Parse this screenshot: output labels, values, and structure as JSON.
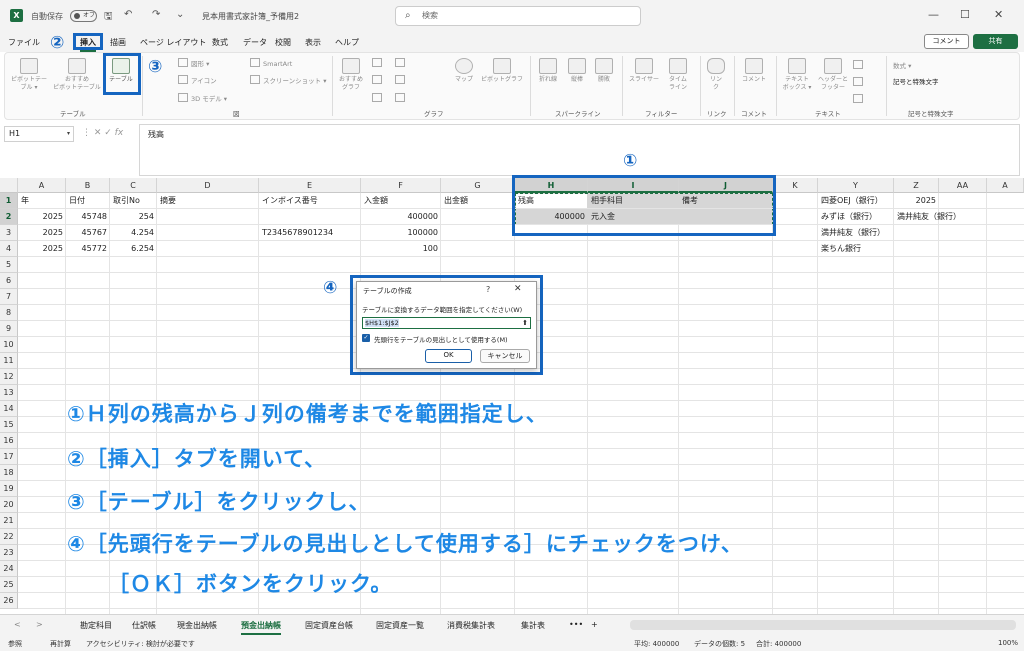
{
  "titlebar": {
    "autosave_label": "自動保存",
    "autosave_state": "オフ",
    "doc_title": "見本用書式家計簿_予備用2",
    "search_placeholder": "検索",
    "win_min": "—",
    "win_max": "☐",
    "win_close": "✕"
  },
  "menu": {
    "tabs": [
      "ファイル",
      "挿入",
      "描画",
      "ページ レイアウト",
      "数式",
      "データ",
      "校閲",
      "表示",
      "ヘルプ"
    ],
    "comment": "コメント",
    "share": "共有"
  },
  "ribbon": {
    "pivot": "ピボットテー\nブル ▾",
    "rec_pivot": "おすすめ\nピボットテーブル",
    "table": "テーブル",
    "shapes": "図形 ▾",
    "icons": "アイコン",
    "model3d": "3D モデル ▾",
    "smartart": "SmartArt",
    "screenshot": "スクリーンショット ▾",
    "rec_chart": "おすすめ\nグラフ",
    "map": "マップ",
    "pivot_chart": "ピボットグラフ",
    "line": "折れ線",
    "column": "縦棒",
    "winloss": "勝敗",
    "slicer": "スライサー",
    "timeline": "タイム\nライン",
    "link": "リン\nク",
    "comment": "コメント",
    "textbox": "テキスト\nボックス ▾",
    "header_footer": "ヘッダーと\nフッター",
    "equation": "数式 ▾",
    "symbol": "記号と特殊文字",
    "groups": [
      "テーブル",
      "図",
      "グラフ",
      "スパークライン",
      "フィルター",
      "リンク",
      "コメント",
      "テキスト",
      "記号と特殊文字"
    ]
  },
  "formula_bar": {
    "name_box": "H1",
    "fx": "fx",
    "content": "残高"
  },
  "grid": {
    "columns": [
      "A",
      "B",
      "C",
      "D",
      "E",
      "F",
      "G",
      "H",
      "I",
      "J",
      "K",
      "Y",
      "Z",
      "AA",
      "A"
    ],
    "rows": [
      "1",
      "2",
      "3",
      "4",
      "5",
      "6",
      "7",
      "8",
      "9",
      "10",
      "11",
      "12",
      "13",
      "14",
      "15",
      "16",
      "17",
      "18",
      "19",
      "20",
      "21",
      "22",
      "23",
      "24",
      "25",
      "26"
    ],
    "row1": [
      "年",
      "日付",
      "取引No",
      "摘要",
      "インボイス番号",
      "入金額",
      "出金額",
      "残高",
      "相手科目",
      "備考",
      "",
      "四菱OEJ（銀行）",
      "2025"
    ],
    "row2": [
      "2025",
      "45748",
      "254",
      "",
      "",
      "400000",
      "",
      "400000",
      "元入金",
      "",
      "",
      "みずほ（銀行）",
      "満井純友（銀行）"
    ],
    "row3": [
      "2025",
      "45767",
      "4.254",
      "",
      "T2345678901234",
      "100000",
      "",
      "",
      "",
      "",
      "",
      "満井純友（銀行）",
      ""
    ],
    "row4": [
      "2025",
      "45772",
      "6.254",
      "",
      "",
      "100",
      "",
      "",
      "",
      "",
      "",
      "楽ちん銀行",
      ""
    ]
  },
  "dialog": {
    "title": "テーブルの作成",
    "help": "?",
    "close": "✕",
    "prompt": "テーブルに変換するデータ範囲を指定してください(W)",
    "range": "$H$1:$J$2",
    "upload_icon": "⬆",
    "checkbox_label": "先頭行をテーブルの見出しとして使用する(M)",
    "ok": "OK",
    "cancel": "キャンセル"
  },
  "markers": {
    "m1": "①",
    "m2": "②",
    "m3": "③",
    "m4": "④"
  },
  "instructions": [
    "①Ｈ列の残高からＪ列の備考までを範囲指定し、",
    "②［挿入］タブを開いて、",
    "③［テーブル］をクリックし、",
    "④［先頭行をテーブルの見出しとして使用する］にチェックをつけ、",
    "［ＯＫ］ボタンをクリック。"
  ],
  "sheets": {
    "tabs": [
      "勘定科目",
      "仕訳帳",
      "現金出納帳",
      "預金出納帳",
      "固定資産台帳",
      "固定資産一覧",
      "消費税集計表",
      "集計表"
    ],
    "more": "•••",
    "add": "+"
  },
  "status": {
    "mode": "参照",
    "recalc": "再計算",
    "accessibility": "アクセシビリティ: 検討が必要です",
    "average": "平均: 400000",
    "count": "データの個数: 5",
    "sum": "合計: 400000",
    "zoom": "100%"
  },
  "colors": {
    "excel_green": "#1d6f42",
    "annotation_blue": "#1565c0",
    "instruction_blue": "#1e88e5"
  }
}
